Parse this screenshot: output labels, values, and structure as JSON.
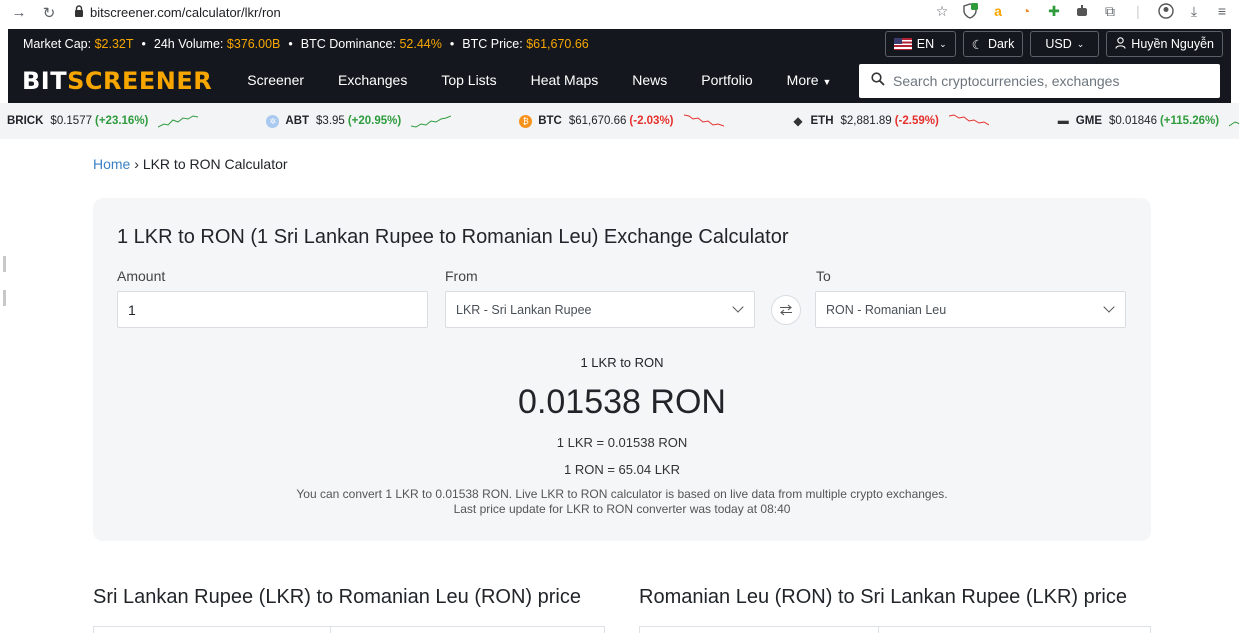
{
  "browser": {
    "url": "bitscreener.com/calculator/lkr/ron"
  },
  "stats": {
    "market_cap_label": "Market Cap:",
    "market_cap": "$2.32T",
    "volume_label": "24h Volume:",
    "volume": "$376.00B",
    "dominance_label": "BTC Dominance:",
    "dominance": "52.44%",
    "btc_price_label": "BTC Price:",
    "btc_price": "$61,670.66"
  },
  "controls": {
    "language": "EN",
    "theme": "Dark",
    "currency": "USD",
    "user": "Huyền Nguyễn"
  },
  "logo": {
    "part1": "BIT",
    "part2": "S",
    "part3": "CREENER"
  },
  "nav": {
    "items": [
      "Screener",
      "Exchanges",
      "Top Lists",
      "Heat Maps",
      "News",
      "Portfolio",
      "More"
    ]
  },
  "search": {
    "placeholder": "Search cryptocurrencies, exchanges"
  },
  "ticker": [
    {
      "symbol": "BRICK",
      "price": "$0.1577",
      "change": "(+23.16%)",
      "direction": "up"
    },
    {
      "symbol": "ABT",
      "price": "$3.95",
      "change": "(+20.95%)",
      "direction": "up"
    },
    {
      "symbol": "BTC",
      "price": "$61,670.66",
      "change": "(-2.03%)",
      "direction": "down"
    },
    {
      "symbol": "ETH",
      "price": "$2,881.89",
      "change": "(-2.59%)",
      "direction": "down"
    },
    {
      "symbol": "GME",
      "price": "$0.01846",
      "change": "(+115.26%)",
      "direction": "up"
    }
  ],
  "breadcrumb": {
    "home": "Home",
    "separator": "›",
    "current": "LKR to RON Calculator"
  },
  "calculator": {
    "title": "1 LKR to RON (1 Sri Lankan Rupee to Romanian Leu) Exchange Calculator",
    "amount_label": "Amount",
    "amount_value": "1",
    "from_label": "From",
    "from_value": "LKR - Sri Lankan Rupee",
    "to_label": "To",
    "to_value": "RON - Romanian Leu",
    "result_sub": "1 LKR to RON",
    "result_main": "0.01538 RON",
    "rate1": "1 LKR = 0.01538 RON",
    "rate2": "1 RON = 65.04 LKR",
    "note_line1": "You can convert 1 LKR to 0.01538 RON. Live LKR to RON calculator is based on live data from multiple crypto exchanges.",
    "note_line2": "Last price update for LKR to RON converter was today at 08:40"
  },
  "sections": {
    "left_title": "Sri Lankan Rupee (LKR) to Romanian Leu (RON) price",
    "right_title": "Romanian Leu (RON) to Sri Lankan Rupee (LKR) price"
  },
  "colors": {
    "accent": "#f7a600",
    "dark_bg": "#14181e",
    "up": "#2e9b3d",
    "down": "#e5302c",
    "link": "#3b82c4"
  }
}
